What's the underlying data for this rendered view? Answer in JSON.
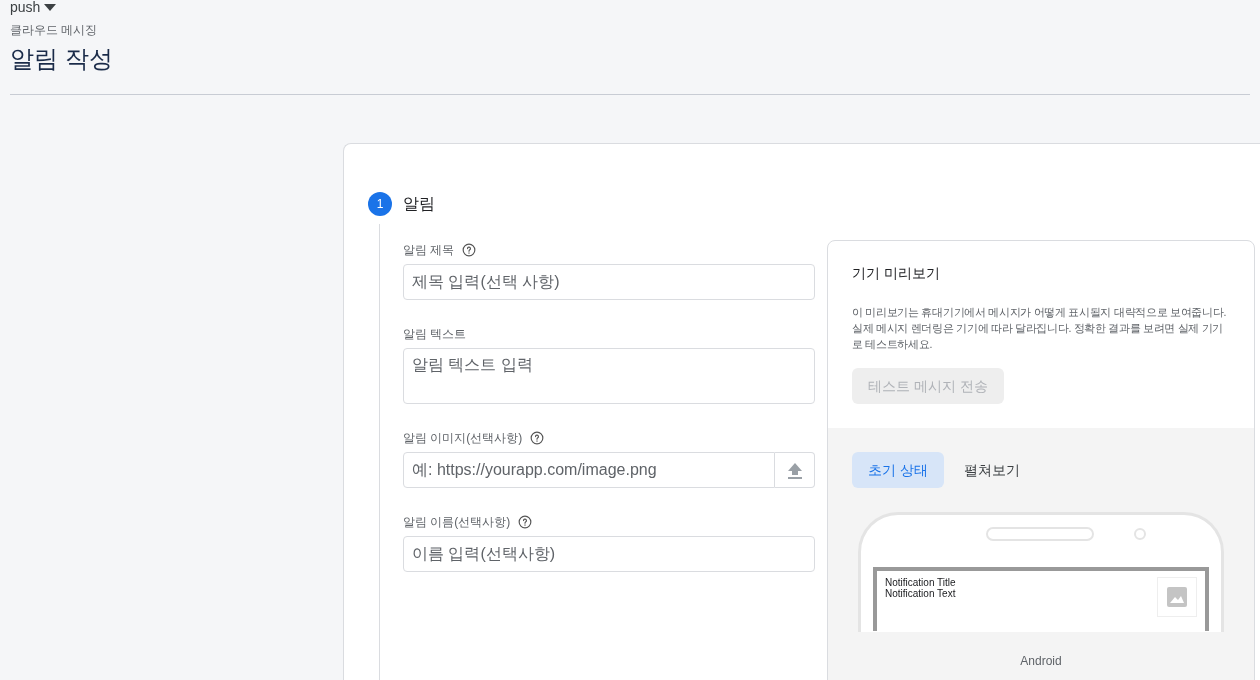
{
  "project_selector": {
    "label": "push"
  },
  "breadcrumb": "클라우드 메시징",
  "page_title": "알림 작성",
  "step": {
    "number": "1",
    "title": "알림"
  },
  "fields": [
    {
      "kind": "text",
      "label": "알림 제목",
      "help": true,
      "placeholder": "제목 입력(선택 사항)"
    },
    {
      "kind": "textarea",
      "label": "알림 텍스트",
      "help": false,
      "placeholder": "알림 텍스트 입력"
    },
    {
      "kind": "upload",
      "label": "알림 이미지(선택사항)",
      "help": true,
      "placeholder": "예: https://yourapp.com/image.png"
    },
    {
      "kind": "text",
      "label": "알림 이름(선택사항)",
      "help": true,
      "placeholder": "이름 입력(선택사항)"
    }
  ],
  "preview": {
    "title": "기기 미리보기",
    "description": "이 미리보기는 휴대기기에서 메시지가 어떻게 표시될지 대략적으로 보여줍니다. 실제 메시지 렌더링은 기기에 따라 달라집니다. 정확한 결과를 보려면 실제 기기로 테스트하세요.",
    "test_button": {
      "label": "테스트 메시지 전송",
      "disabled": true
    },
    "tabs": [
      {
        "label": "초기 상태",
        "selected": true
      },
      {
        "label": "펼쳐보기",
        "selected": false
      }
    ],
    "notification": {
      "title": "Notification Title",
      "text": "Notification Text"
    },
    "device_label": "Android"
  }
}
